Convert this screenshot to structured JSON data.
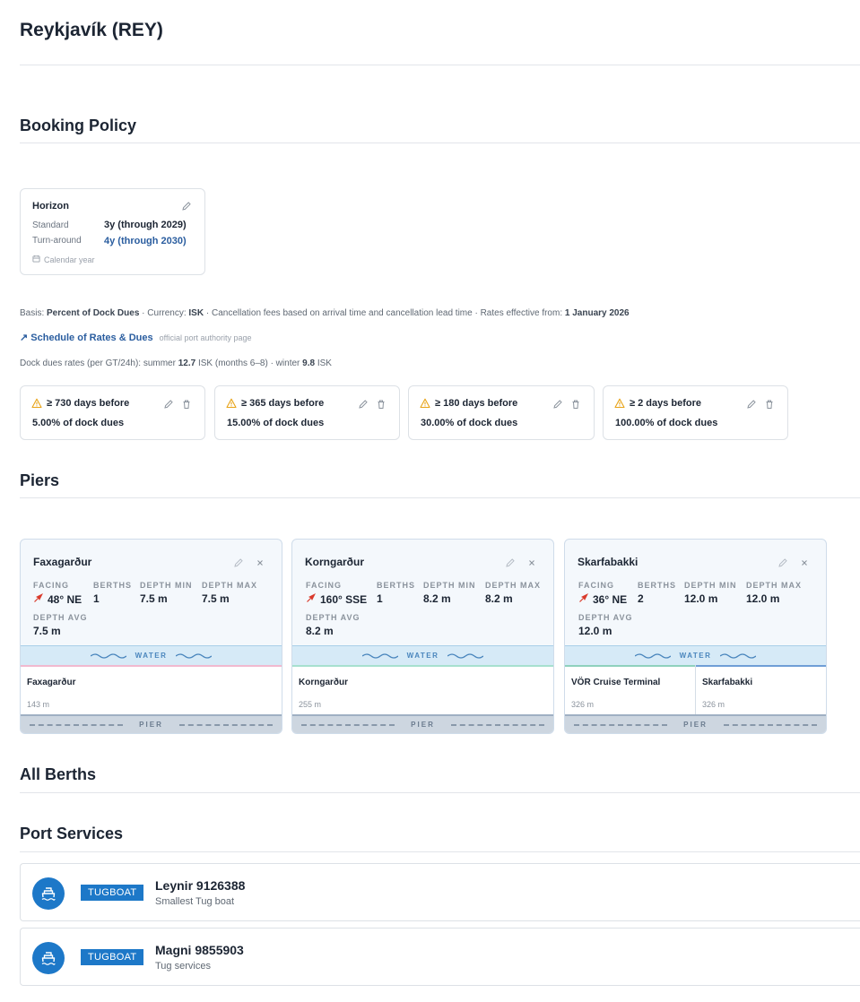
{
  "port": {
    "title": "Reykjavík (REY)"
  },
  "sections": {
    "booking_policy": "Booking Policy",
    "piers": "Piers",
    "all_berths": "All Berths",
    "port_services": "Port Services"
  },
  "horizon": {
    "title": "Horizon",
    "rows": [
      {
        "label": "Standard",
        "value": "3y (through 2029)"
      },
      {
        "label": "Turn-around",
        "value": "4y (through 2030)"
      }
    ],
    "footer": "Calendar year"
  },
  "basis": {
    "basis_label": "Basis:",
    "basis_value": "Percent of Dock Dues",
    "currency_label": "· Currency:",
    "currency_value": "ISK",
    "cancellation_text": "· Cancellation fees based on arrival time and cancellation lead time · Rates effective from:",
    "effective_value": "1 January 2026"
  },
  "schedule_link": {
    "text": "↗ Schedule of Rates & Dues",
    "note": "official port authority page"
  },
  "dock_dues": {
    "prefix": "Dock dues rates (per GT/24h): summer",
    "summer_value": "12.7",
    "summer_suffix": "ISK (months 6–8) · winter",
    "winter_value": "9.8",
    "winter_suffix": "ISK"
  },
  "fees": [
    {
      "threshold": "≥ 730 days before",
      "value": "5.00% of dock dues"
    },
    {
      "threshold": "≥ 365 days before",
      "value": "15.00% of dock dues"
    },
    {
      "threshold": "≥ 180 days before",
      "value": "30.00% of dock dues"
    },
    {
      "threshold": "≥ 2 days before",
      "value": "100.00% of dock dues"
    }
  ],
  "pier_labels": {
    "facing": "Facing",
    "berths": "Berths",
    "depth_min": "Depth Min",
    "depth_max": "Depth Max",
    "depth_avg": "Depth Avg",
    "water": "WATER",
    "pier": "PIER"
  },
  "piers": [
    {
      "name": "Faxagarður",
      "facing": "48° NE",
      "berths": "1",
      "depth_min": "7.5 m",
      "depth_max": "7.5 m",
      "depth_avg": "7.5 m",
      "berth_list": [
        {
          "name": "Faxagarður",
          "length": "143 m",
          "color": "#f1b9cf"
        }
      ]
    },
    {
      "name": "Korngarður",
      "facing": "160° SSE",
      "berths": "1",
      "depth_min": "8.2 m",
      "depth_max": "8.2 m",
      "depth_avg": "8.2 m",
      "berth_list": [
        {
          "name": "Korngarður",
          "length": "255 m",
          "color": "#a7e0cf"
        }
      ]
    },
    {
      "name": "Skarfabakki",
      "facing": "36° NE",
      "berths": "2",
      "depth_min": "12.0 m",
      "depth_max": "12.0 m",
      "depth_avg": "12.0 m",
      "berth_list": [
        {
          "name": "VÖR Cruise Terminal",
          "length": "326 m",
          "color": "#8fd1bd"
        },
        {
          "name": "Skarfabakki",
          "length": "326 m",
          "color": "#6f9ed6"
        }
      ]
    }
  ],
  "services": [
    {
      "badge": "TUGBOAT",
      "name": "Leynir 9126388",
      "description": "Smallest Tug boat"
    },
    {
      "badge": "TUGBOAT",
      "name": "Magni 9855903",
      "description": "Tug services"
    }
  ],
  "colors": {
    "accent": "#1d78c8",
    "link": "#2a5d9f",
    "warning": "#e8a317",
    "facing_arrow": "#d93a2b"
  }
}
